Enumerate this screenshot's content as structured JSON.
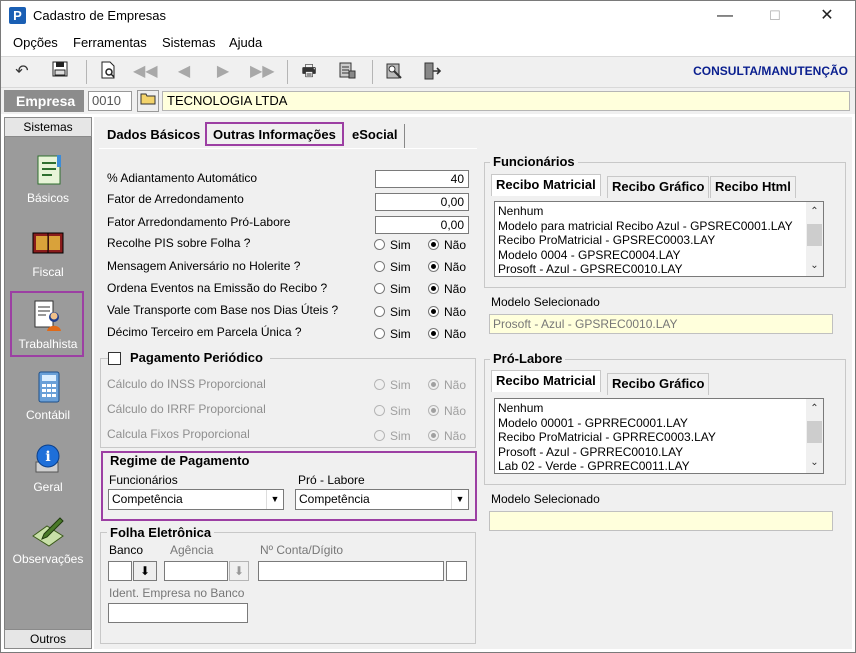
{
  "window": {
    "title": "Cadastro de Empresas",
    "app_icon_letter": "P",
    "controls": {
      "minimize": "—",
      "maximize": "☐",
      "close": "✕"
    }
  },
  "menu": [
    "Opções",
    "Ferramentas",
    "Sistemas",
    "Ajuda"
  ],
  "toolbar": {
    "icons": [
      "undo-icon",
      "save-icon",
      "preview-icon",
      "first-icon",
      "prev-icon",
      "next-icon",
      "last-icon",
      "print-icon",
      "report-icon",
      "tools-icon",
      "exit-icon"
    ],
    "mode": "CONSULTA/MANUTENÇÃO"
  },
  "empresa": {
    "label": "Empresa",
    "code": "0010",
    "name": "TECNOLOGIA LTDA"
  },
  "sidebar": {
    "header": "Sistemas",
    "footer": "Outros",
    "items": [
      {
        "label": "Básicos",
        "icon": "notebook-icon"
      },
      {
        "label": "Fiscal",
        "icon": "book-icon"
      },
      {
        "label": "Trabalhista",
        "icon": "worker-icon",
        "selected": true
      },
      {
        "label": "Contábil",
        "icon": "calculator-icon"
      },
      {
        "label": "Geral",
        "icon": "info-icon"
      },
      {
        "label": "Observações",
        "icon": "pen-icon"
      }
    ]
  },
  "tabs": [
    "Dados Básicos",
    "Outras Informações",
    "eSocial"
  ],
  "active_tab": "Outras Informações",
  "fields": {
    "adiantamento_label": "% Adiantamento Automático",
    "adiantamento_value": "40",
    "fator_label": "Fator de Arredondamento",
    "fator_value": "0,00",
    "fator_pro_label": "Fator Arredondamento Pró-Labore",
    "fator_pro_value": "0,00"
  },
  "radio_questions": [
    {
      "label": "Recolhe PIS sobre Folha ?",
      "value": "Não"
    },
    {
      "label": "Mensagem Aniversário no Holerite ?",
      "value": "Não"
    },
    {
      "label": "Ordena Eventos na Emissão do Recibo ?",
      "value": "Não"
    },
    {
      "label": "Vale Transporte com Base nos Dias Úteis ?",
      "value": "Não"
    },
    {
      "label": "Décimo Terceiro em Parcela Única ?",
      "value": "Não"
    }
  ],
  "radio_options": {
    "yes": "Sim",
    "no": "Não"
  },
  "pagamento_periodico": {
    "title": "Pagamento Periódico",
    "checked": false,
    "items": [
      "Cálculo do INSS Proporcional",
      "Cálculo do IRRF Proporcional",
      "Calcula Fixos Proporcional"
    ]
  },
  "regime": {
    "title": "Regime de Pagamento",
    "funcionarios_label": "Funcionários",
    "funcionarios_value": "Competência",
    "prolabore_label": "Pró - Labore",
    "prolabore_value": "Competência"
  },
  "folha": {
    "title": "Folha Eletrônica",
    "banco_label": "Banco",
    "agencia_label": "Agência",
    "conta_label": "Nº Conta/Dígito",
    "ident_label": "Ident. Empresa no Banco"
  },
  "funcionarios": {
    "title": "Funcionários",
    "tabs": [
      "Recibo Matricial",
      "Recibo Gráfico",
      "Recibo Html"
    ],
    "list": [
      "Nenhum",
      "Modelo para matricial Recibo Azul - GPSREC0001.LAY",
      "Recibo ProMatricial - GPSREC0003.LAY",
      "Modelo 0004 - GPSREC0004.LAY",
      "Prosoft - Azul - GPSREC0010.LAY"
    ],
    "selected_label": "Modelo Selecionado",
    "selected_value": "Prosoft - Azul - GPSREC0010.LAY"
  },
  "prolabore": {
    "title": "Pró-Labore",
    "tabs": [
      "Recibo Matricial",
      "Recibo Gráfico"
    ],
    "list": [
      "Nenhum",
      "Modelo 00001 - GPRREC0001.LAY",
      "Recibo ProMatricial - GPRREC0003.LAY",
      "Prosoft - Azul - GPRREC0010.LAY",
      "Lab 02 - Verde - GPRREC0011.LAY"
    ],
    "selected_label": "Modelo Selecionado",
    "selected_value": ""
  }
}
